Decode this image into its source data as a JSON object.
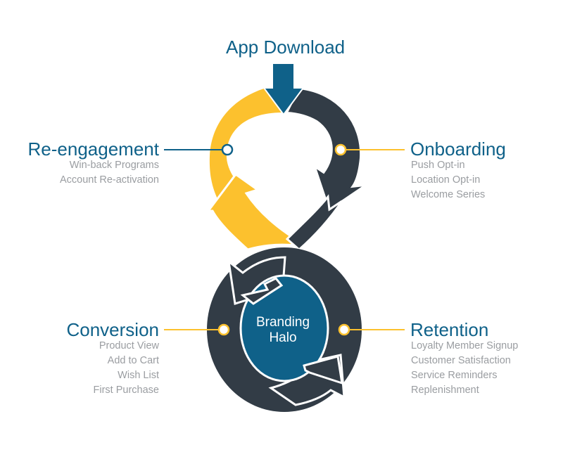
{
  "diagram": {
    "top": {
      "title": "App Download"
    },
    "reengagement": {
      "title": "Re-engagement",
      "items": [
        "Win-back Programs",
        "Account Re-activation"
      ]
    },
    "onboarding": {
      "title": "Onboarding",
      "items": [
        "Push Opt-in",
        "Location Opt-in",
        "Welcome Series"
      ]
    },
    "conversion": {
      "title": "Conversion",
      "items": [
        "Product View",
        "Add to Cart",
        "Wish List",
        "First Purchase"
      ]
    },
    "retention": {
      "title": "Retention",
      "items": [
        "Loyalty Member Signup",
        "Customer Satisfaction",
        "Service Reminders",
        "Replenishment"
      ]
    },
    "center": {
      "line1": "Branding",
      "line2": "Halo"
    }
  },
  "colors": {
    "blue": "#0f6189",
    "yellow": "#fcc12e",
    "dark": "#323c46",
    "gray_text": "#9a9da1"
  }
}
